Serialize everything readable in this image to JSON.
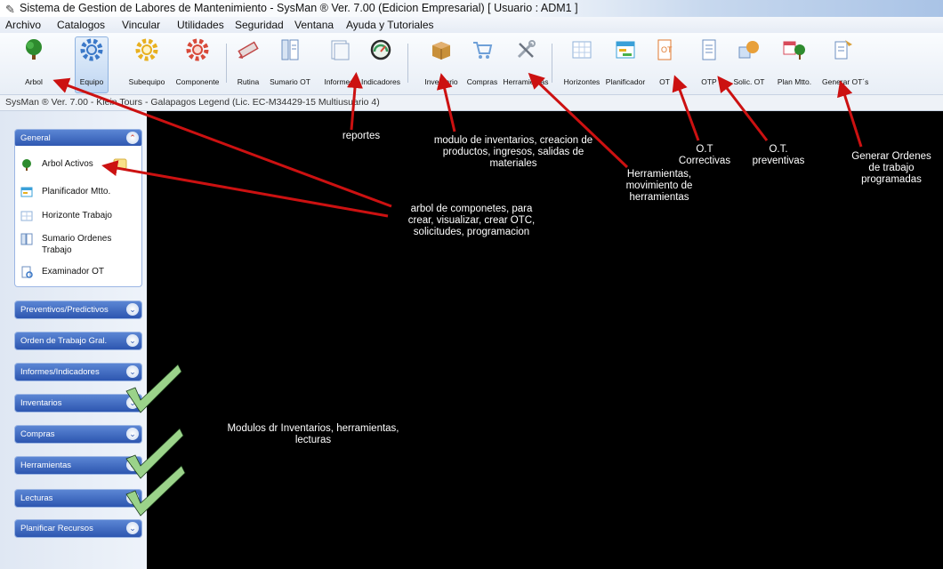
{
  "window": {
    "title": "Sistema de Gestion de Labores de Mantenimiento - SysMan ® Ver. 7.00  (Edicion Empresarial)  [ Usuario : ADM1 ]"
  },
  "menu": [
    "Archivo",
    "Catalogos",
    "Vincular",
    "Utilidades",
    "Seguridad",
    "Ventana",
    "Ayuda y Tutoriales"
  ],
  "toolbar": {
    "buttons": [
      {
        "label": "Arbol",
        "icon": "tree-icon",
        "color": "#2e8b2e"
      },
      {
        "label": "Equipo",
        "icon": "gear-icon",
        "color": "#3a78c8"
      },
      {
        "label": "Subequipo",
        "icon": "gear-icon",
        "color": "#e8b020"
      },
      {
        "label": "Componente",
        "icon": "gear-icon",
        "color": "#d84a3a"
      },
      {
        "label": "Rutina",
        "icon": "pencil-icon",
        "color": "#c04848"
      },
      {
        "label": "Sumario OT",
        "icon": "document-icon",
        "color": "#6c8fc0"
      },
      {
        "label": "Informes",
        "icon": "report-icon",
        "color": "#8fa7c8"
      },
      {
        "label": "Indicadores",
        "icon": "gauge-icon",
        "color": "#3a7a5a"
      },
      {
        "label": "Inventario",
        "icon": "box-icon",
        "color": "#c8903a"
      },
      {
        "label": "Compras",
        "icon": "cart-icon",
        "color": "#6fa0d8"
      },
      {
        "label": "Herramientas",
        "icon": "tools-icon",
        "color": "#9aa4b0"
      },
      {
        "label": "Horizontes",
        "icon": "calendar-grid-icon",
        "color": "#8fb0d8"
      },
      {
        "label": "Planificador",
        "icon": "planner-icon",
        "color": "#3aa0d8"
      },
      {
        "label": "OT",
        "icon": "document-icon",
        "color": "#e07a30"
      },
      {
        "label": "OTP",
        "icon": "document-icon",
        "color": "#6c8fc0"
      },
      {
        "label": "Solic. OT",
        "icon": "request-icon",
        "color": "#e8a03a"
      },
      {
        "label": "Plan Mtto.",
        "icon": "calendar-tree-icon",
        "color": "#d84a5a"
      },
      {
        "label": "Generar OT´s",
        "icon": "generate-icon",
        "color": "#d8a03a"
      }
    ]
  },
  "status_line": "SysMan ® Ver. 7.00 - Klein Tours - Galapagos Legend  (Lic. EC-M34429-15 Multiusuario 4)",
  "sidebar": {
    "general": {
      "title": "General",
      "items": [
        {
          "label": "Arbol Activos",
          "icon": "tree-icon"
        },
        {
          "label": "Planificador Mtto.",
          "icon": "planner-icon"
        },
        {
          "label": "Horizonte Trabajo",
          "icon": "calendar-grid-icon"
        },
        {
          "label": "Sumario Ordenes Trabajo",
          "icon": "document-icon"
        },
        {
          "label": "Examinador OT",
          "icon": "report-icon"
        }
      ]
    },
    "groups": [
      "Preventivos/Predictivos",
      "Orden de Trabajo Gral.",
      "Informes/Indicadores",
      "Inventarios",
      "Compras",
      "Herramientas",
      "Lecturas",
      "Planificar Recursos"
    ]
  },
  "annotations": {
    "reportes": "reportes",
    "inventarios": [
      "modulo de inventarios, creacion de",
      "productos, ingresos, salidas de",
      "materiales"
    ],
    "herramientas": [
      "Herramientas,",
      "movimiento de",
      "herramientas"
    ],
    "ot_correctivas": [
      "O.T",
      "Correctivas"
    ],
    "ot_preventivas": [
      "O.T.",
      "preventivas"
    ],
    "generar": [
      "Generar Ordenes",
      "de trabajo",
      "programadas"
    ],
    "arbol": [
      "arbol de componetes, para",
      "crear, visualizar, crear OTC,",
      "solicitudes, programacion"
    ],
    "modulos": [
      "Modulos dr Inventarios, herramientas,",
      "lecturas"
    ]
  },
  "colors": {
    "annotation_arrow": "#cc1111",
    "checkmark": "#9bd38a",
    "sidebar_group": "#2d56b0"
  }
}
